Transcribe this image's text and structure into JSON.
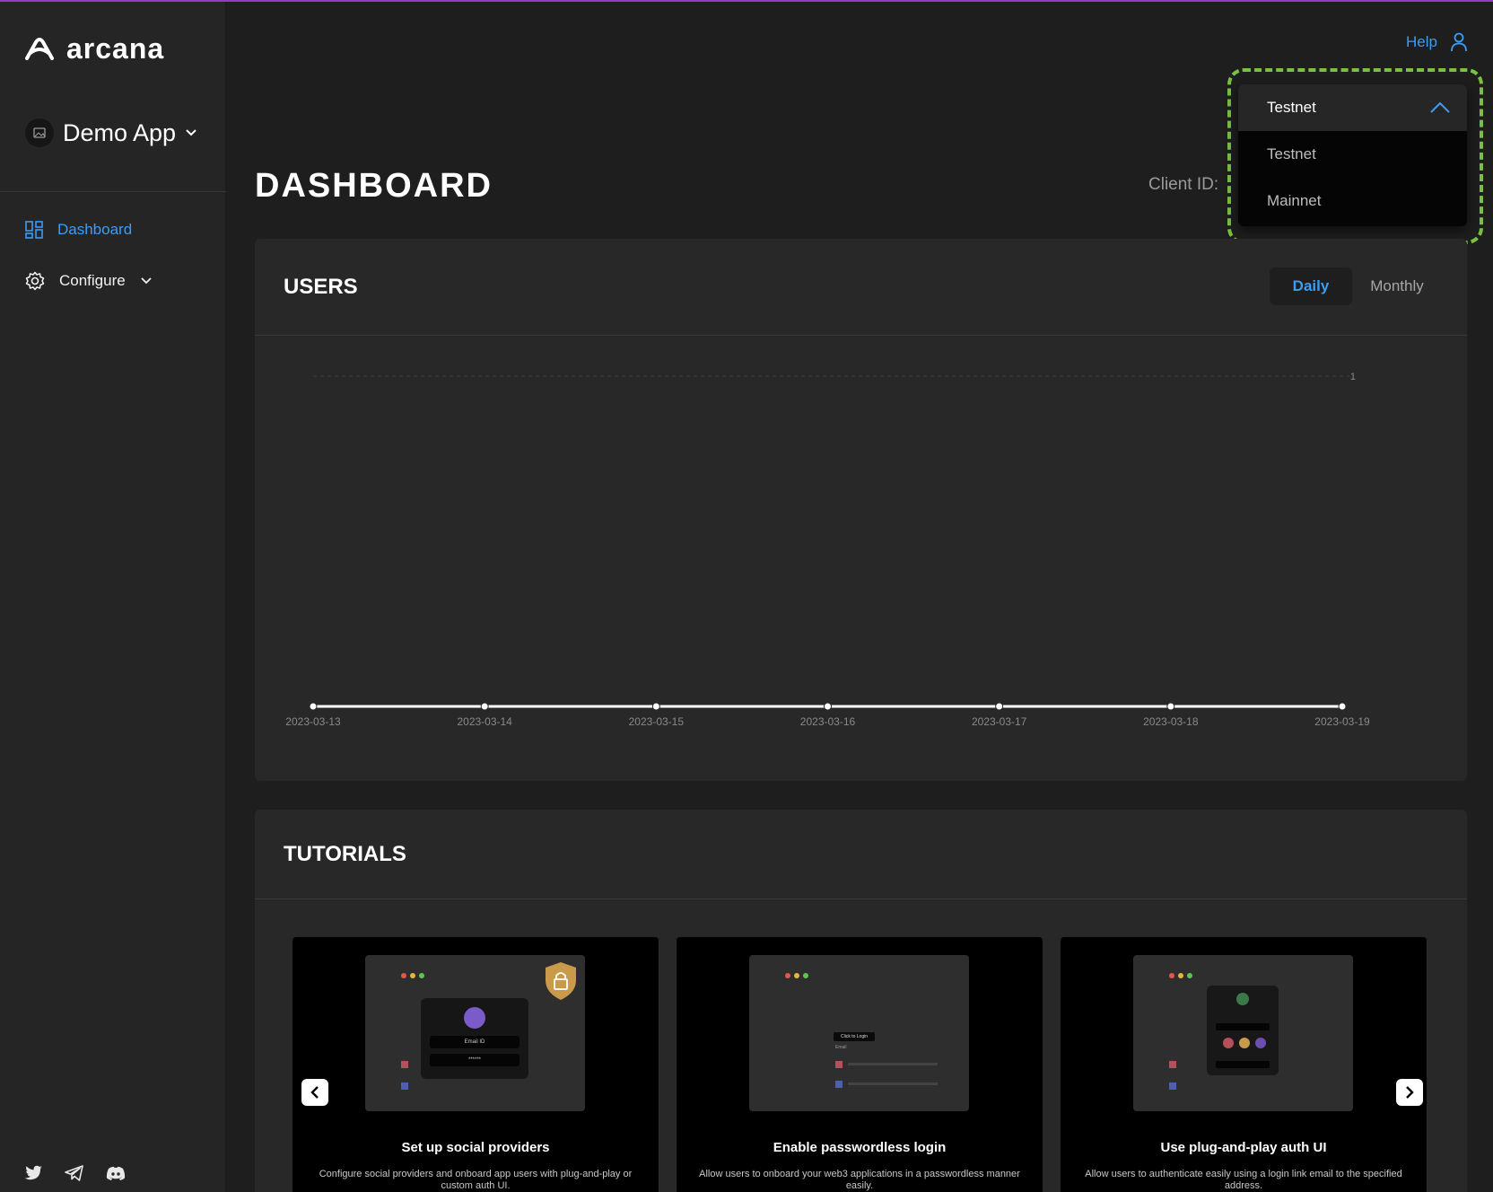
{
  "brand": {
    "name": "arcana"
  },
  "app_selector": {
    "name": "Demo App",
    "icon": "image-icon"
  },
  "sidebar": {
    "items": [
      {
        "label": "Dashboard",
        "icon": "dashboard-icon",
        "active": true
      },
      {
        "label": "Configure",
        "icon": "gear-icon",
        "active": false
      }
    ],
    "social": [
      "twitter-icon",
      "telegram-icon",
      "discord-icon"
    ]
  },
  "header": {
    "help_label": "Help",
    "user_icon": "user-icon"
  },
  "page": {
    "title": "DASHBOARD",
    "client_id_label": "Client ID:"
  },
  "network_dropdown": {
    "selected": "Testnet",
    "options": [
      "Testnet",
      "Mainnet"
    ]
  },
  "users": {
    "title": "USERS",
    "toggle": {
      "daily": "Daily",
      "monthly": "Monthly",
      "selected": "Daily"
    }
  },
  "chart_data": {
    "type": "line",
    "x": [
      "2023-03-13",
      "2023-03-14",
      "2023-03-15",
      "2023-03-16",
      "2023-03-17",
      "2023-03-18",
      "2023-03-19"
    ],
    "series": [
      {
        "values": [
          0,
          0,
          0,
          0,
          0,
          0,
          0
        ]
      }
    ],
    "ylim": [
      0,
      1
    ],
    "yticks": [
      "1"
    ],
    "grid": true
  },
  "tutorials": {
    "title": "TUTORIALS",
    "cards": [
      {
        "title": "Set up social providers",
        "description": "Configure social providers and onboard app users with plug-and-play or custom auth UI.",
        "thumb_label_1": "Email ID",
        "thumb_label_2": "******"
      },
      {
        "title": "Enable passwordless login",
        "description": "Allow users to onboard your web3 applications in a passwordless manner easily.",
        "thumb_label_1": "Click to Login",
        "thumb_label_2": "Email"
      },
      {
        "title": "Use plug-and-play auth UI",
        "description": "Allow users to authenticate easily using a login link email to the specified address."
      }
    ]
  },
  "colors": {
    "accent": "#3d9cf5",
    "highlight": "#7cc043",
    "top_bar": "#8a3fc7"
  }
}
